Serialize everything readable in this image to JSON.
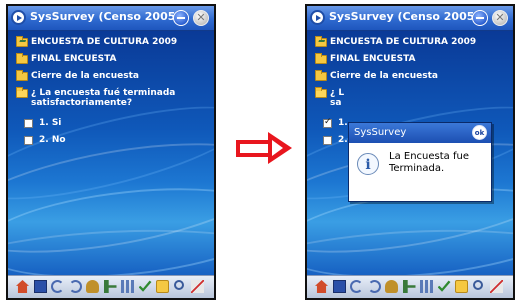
{
  "app": {
    "title": "SysSurvey (Censo 2005)",
    "close_glyph": "✕"
  },
  "tree": {
    "root_label": "ENCUESTA DE CULTURA 2009",
    "section_label": "FINAL ENCUESTA",
    "subsection_label": "Cierre de la encuesta",
    "question_label": "¿ La encuesta fué terminada satisfactoriamente?",
    "options": [
      "1. Si",
      "2. No"
    ]
  },
  "right_tree": {
    "question_label_visible": "¿ L",
    "question_label_line2": "sa",
    "option1_visible": "1.",
    "option2_visible": "2."
  },
  "dialog": {
    "title": "SysSurvey",
    "ok_label": "ok",
    "icon_glyph": "i",
    "message": "La Encuesta fue Terminada."
  },
  "toolbar_icons": [
    "home-icon",
    "save-icon",
    "undo-icon",
    "redo-icon",
    "person-icon",
    "tree-icon",
    "grid-icon",
    "check-icon",
    "folder-icon",
    "search-icon",
    "chart-icon"
  ],
  "colors": {
    "arrow": "#e8161e",
    "title_bar": "#2f6ad0",
    "background": "#0d3f9f"
  }
}
